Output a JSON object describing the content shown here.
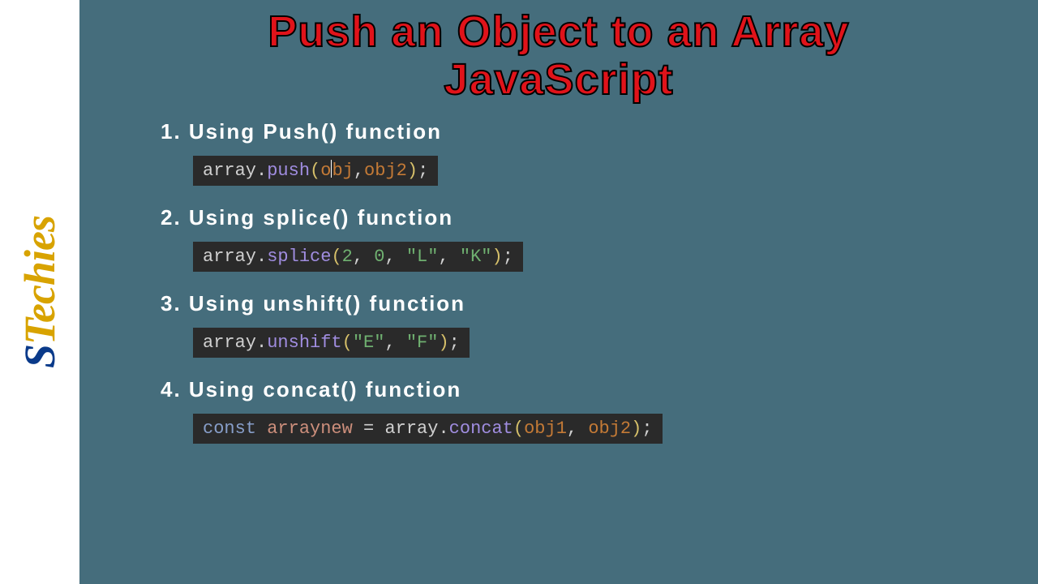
{
  "logo": {
    "s": "S",
    "t": "T",
    "ech": "ech",
    "ies": "ies"
  },
  "title_line1": "Push an Object to an Array",
  "title_line2": "JavaScript",
  "sections": [
    {
      "heading": "1. Using Push() function",
      "code": {
        "obj": "array",
        "dot": ".",
        "method": "push",
        "open": "(",
        "arg1a": "o",
        "arg1b": "bj",
        "comma": ",",
        "arg2": "obj2",
        "close": ")",
        "semi": ";"
      }
    },
    {
      "heading": "2. Using splice() function",
      "code": {
        "obj": "array",
        "dot": ".",
        "method": "splice",
        "open": "(",
        "n1": "2",
        "c1": ", ",
        "n2": "0",
        "c2": ", ",
        "s1": "\"L\"",
        "c3": ", ",
        "s2": "\"K\"",
        "close": ")",
        "semi": ";"
      }
    },
    {
      "heading": "3. Using unshift() function",
      "code": {
        "obj": "array",
        "dot": ".",
        "method": "unshift",
        "open": "(",
        "s1": "\"E\"",
        "c1": ", ",
        "s2": "\"F\"",
        "close": ")",
        "semi": ";"
      }
    },
    {
      "heading": "4. Using concat() function",
      "code": {
        "kw": "const",
        "sp1": " ",
        "var": "arraynew",
        "sp2": " ",
        "eq": "=",
        "sp3": " ",
        "obj": "array",
        "dot": ".",
        "method": "concat",
        "open": "(",
        "a1": "obj1",
        "c1": ", ",
        "a2": "obj2",
        "close": ")",
        "semi": ";"
      }
    }
  ]
}
